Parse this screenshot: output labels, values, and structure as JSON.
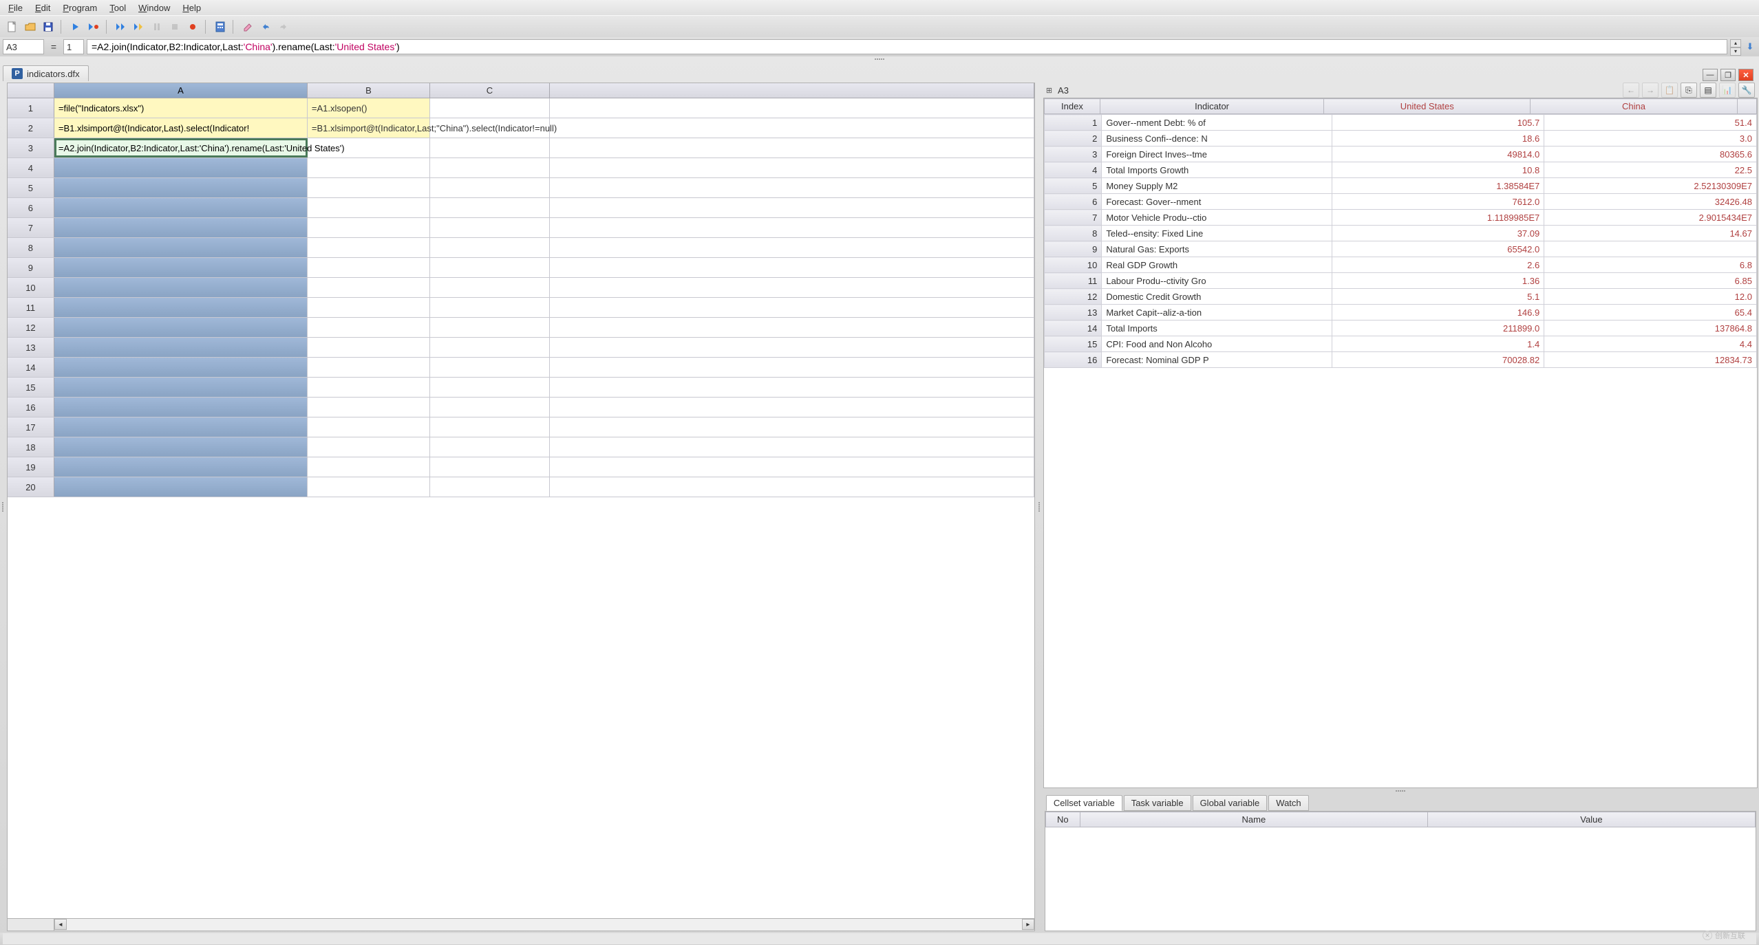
{
  "menu": {
    "file": "File",
    "edit": "Edit",
    "program": "Program",
    "tool": "Tool",
    "window": "Window",
    "help": "Help"
  },
  "formula_bar": {
    "cell_ref": "A3",
    "row_ref": "1",
    "formula_prefix": "=A2.join(Indicator,B2:Indicator,Last:",
    "formula_str1": "'China'",
    "formula_mid": ").rename(Last:",
    "formula_str2": "'United States'",
    "formula_suffix": ")"
  },
  "document": {
    "filename": "indicators.dfx",
    "tab_icon_letter": "P"
  },
  "grid": {
    "columns": [
      "A",
      "B",
      "C"
    ],
    "rows": [
      {
        "n": 1,
        "A": "=file(\"Indicators.xlsx\")",
        "B": "=A1.xlsopen()",
        "C": "",
        "yellow": true
      },
      {
        "n": 2,
        "A": "=B1.xlsimport@t(Indicator,Last).select(Indicator!",
        "B": "=B1.xlsimport@t(Indicator,Last;\"China\").select(Indicator!=null)",
        "C": "",
        "yellow": true
      },
      {
        "n": 3,
        "A": "=A2.join(Indicator,B2:Indicator,Last:'China').rename(Last:'United States')",
        "B": "",
        "C": "",
        "selected": true
      },
      {
        "n": 4
      },
      {
        "n": 5
      },
      {
        "n": 6
      },
      {
        "n": 7
      },
      {
        "n": 8
      },
      {
        "n": 9
      },
      {
        "n": 10
      },
      {
        "n": 11
      },
      {
        "n": 12
      },
      {
        "n": 13
      },
      {
        "n": 14
      },
      {
        "n": 15
      },
      {
        "n": 16
      },
      {
        "n": 17
      },
      {
        "n": 18
      },
      {
        "n": 19
      },
      {
        "n": 20
      }
    ]
  },
  "result": {
    "label": "A3",
    "headers": {
      "index": "Index",
      "indicator": "Indicator",
      "united_states": "United States",
      "china": "China"
    },
    "rows": [
      {
        "i": 1,
        "ind": "Gover--nment Debt: % of",
        "us": "105.7",
        "cn": "51.4"
      },
      {
        "i": 2,
        "ind": "Business Confi--dence: N",
        "us": "18.6",
        "cn": "3.0"
      },
      {
        "i": 3,
        "ind": "Foreign Direct Inves--tme",
        "us": "49814.0",
        "cn": "80365.6"
      },
      {
        "i": 4,
        "ind": "Total Imports Growth",
        "us": "10.8",
        "cn": "22.5"
      },
      {
        "i": 5,
        "ind": "Money Supply M2",
        "us": "1.38584E7",
        "cn": "2.52130309E7"
      },
      {
        "i": 6,
        "ind": "Forecast: Gover--nment",
        "us": "7612.0",
        "cn": "32426.48"
      },
      {
        "i": 7,
        "ind": "Motor Vehicle Produ--ctio",
        "us": "1.1189985E7",
        "cn": "2.9015434E7"
      },
      {
        "i": 8,
        "ind": "Teled--ensity: Fixed Line",
        "us": "37.09",
        "cn": "14.67"
      },
      {
        "i": 9,
        "ind": "Natural Gas: Exports",
        "us": "65542.0",
        "cn": ""
      },
      {
        "i": 10,
        "ind": "Real GDP Growth",
        "us": "2.6",
        "cn": "6.8"
      },
      {
        "i": 11,
        "ind": "Labour Produ--ctivity Gro",
        "us": "1.36",
        "cn": "6.85"
      },
      {
        "i": 12,
        "ind": "Domestic Credit Growth",
        "us": "5.1",
        "cn": "12.0"
      },
      {
        "i": 13,
        "ind": "Market Capit--aliz-a-tion",
        "us": "146.9",
        "cn": "65.4"
      },
      {
        "i": 14,
        "ind": "Total Imports",
        "us": "211899.0",
        "cn": "137864.8"
      },
      {
        "i": 15,
        "ind": "CPI: Food and Non Alcoho",
        "us": "1.4",
        "cn": "4.4"
      },
      {
        "i": 16,
        "ind": "Forecast: Nominal GDP P",
        "us": "70028.82",
        "cn": "12834.73"
      }
    ]
  },
  "var_tabs": {
    "cellset": "Cellset variable",
    "task": "Task variable",
    "global": "Global variable",
    "watch": "Watch",
    "headers": {
      "no": "No",
      "name": "Name",
      "value": "Value"
    }
  },
  "watermark": "创新互联"
}
